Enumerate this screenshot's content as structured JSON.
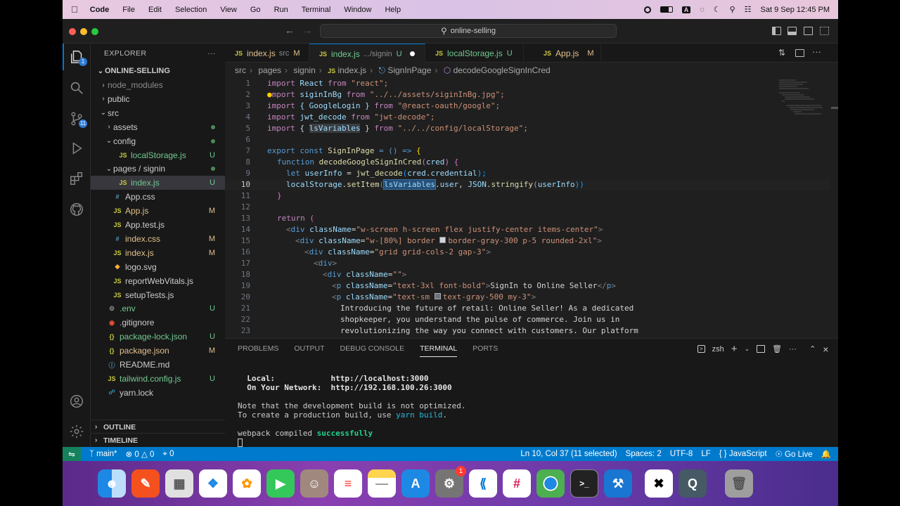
{
  "menubar": {
    "app": "Code",
    "items": [
      "File",
      "Edit",
      "Selection",
      "View",
      "Go",
      "Run",
      "Terminal",
      "Window",
      "Help"
    ],
    "datetime": "Sat 9 Sep  12:45 PM",
    "input_source": "A"
  },
  "window": {
    "search": "online-selling"
  },
  "activity": {
    "source_control_badge": "11",
    "account_badge": "1"
  },
  "explorer": {
    "title": "EXPLORER",
    "project": "ONLINE-SELLING",
    "rows": [
      {
        "label": "node_modules",
        "type": "folder",
        "depth": 1,
        "collapsed": true,
        "status": "",
        "muted": true
      },
      {
        "label": "public",
        "type": "folder",
        "depth": 1,
        "collapsed": true,
        "status": ""
      },
      {
        "label": "src",
        "type": "folder",
        "depth": 1,
        "collapsed": false,
        "status": ""
      },
      {
        "label": "assets",
        "type": "folder",
        "depth": 2,
        "collapsed": true,
        "status": "dot"
      },
      {
        "label": "config",
        "type": "folder",
        "depth": 2,
        "collapsed": false,
        "status": "dot"
      },
      {
        "label": "localStorage.js",
        "type": "js",
        "depth": 3,
        "status": "U"
      },
      {
        "label": "pages / signin",
        "type": "folder",
        "depth": 2,
        "collapsed": false,
        "status": "dot"
      },
      {
        "label": "index.js",
        "type": "js",
        "depth": 3,
        "status": "U",
        "selected": true
      },
      {
        "label": "App.css",
        "type": "css",
        "depth": 2,
        "status": ""
      },
      {
        "label": "App.js",
        "type": "js",
        "depth": 2,
        "status": "M"
      },
      {
        "label": "App.test.js",
        "type": "js",
        "depth": 2,
        "status": ""
      },
      {
        "label": "index.css",
        "type": "css",
        "depth": 2,
        "status": "M"
      },
      {
        "label": "index.js",
        "type": "js",
        "depth": 2,
        "status": "M"
      },
      {
        "label": "logo.svg",
        "type": "svg",
        "depth": 2,
        "status": ""
      },
      {
        "label": "reportWebVitals.js",
        "type": "js",
        "depth": 2,
        "status": ""
      },
      {
        "label": "setupTests.js",
        "type": "js",
        "depth": 2,
        "status": ""
      },
      {
        "label": ".env",
        "type": "env",
        "depth": 1,
        "status": "U"
      },
      {
        "label": ".gitignore",
        "type": "git",
        "depth": 1,
        "status": ""
      },
      {
        "label": "package-lock.json",
        "type": "json",
        "depth": 1,
        "status": "U"
      },
      {
        "label": "package.json",
        "type": "json",
        "depth": 1,
        "status": "M"
      },
      {
        "label": "README.md",
        "type": "md",
        "depth": 1,
        "status": ""
      },
      {
        "label": "tailwind.config.js",
        "type": "js",
        "depth": 1,
        "status": "U"
      },
      {
        "label": "yarn.lock",
        "type": "yarn",
        "depth": 1,
        "status": ""
      }
    ],
    "outline": "OUTLINE",
    "timeline": "TIMELINE"
  },
  "tabs": [
    {
      "name": "index.js",
      "sub": "src",
      "mark": "M",
      "active": false
    },
    {
      "name": "index.js",
      "sub": ".../signin",
      "mark": "U",
      "active": true,
      "dirty": true
    },
    {
      "name": "localStorage.js",
      "sub": "",
      "mark": "U",
      "active": false
    },
    {
      "name": "App.js",
      "sub": "",
      "mark": "M",
      "active": false
    }
  ],
  "breadcrumbs": [
    "src",
    "pages",
    "signin",
    "index.js",
    "SignInPage",
    "decodeGoogleSignInCred"
  ],
  "code": {
    "current_line": 10,
    "lines": [
      "1",
      "2",
      "3",
      "4",
      "5",
      "6",
      "7",
      "8",
      "9",
      "10",
      "11",
      "12",
      "13",
      "14",
      "15",
      "16",
      "17",
      "18",
      "19",
      "20",
      "21",
      "22",
      "23"
    ],
    "text": {
      "l1": [
        "import",
        " React ",
        "from",
        " \"react\";"
      ],
      "l2": [
        "mport",
        " siginInBg ",
        "from",
        " \"../../assets/siginInBg.jpg\";"
      ],
      "l3": [
        "import",
        " { GoogleLogin } ",
        "from",
        " \"@react-oauth/google\";"
      ],
      "l4": [
        "import",
        " jwt_decode ",
        "from",
        " \"jwt-decode\";"
      ],
      "l5": [
        "import",
        " { ",
        "lsVariables",
        " } ",
        "from",
        " \"../../config/localStorage\";"
      ],
      "l7": [
        "export const",
        " SignInPage",
        " = () => ",
        "{"
      ],
      "l8": [
        "function",
        " decodeGoogleSignInCred",
        "(",
        "cred",
        ") {"
      ],
      "l9": [
        "let",
        " userInfo",
        " = ",
        "jwt_decode",
        "(",
        "cred",
        ".",
        "credential",
        ");"
      ],
      "l10": [
        "localStorage",
        ".",
        "setItem",
        "(",
        "lsVariables",
        ".",
        "user",
        ", ",
        "JSON",
        ".",
        "stringify",
        "(",
        "userInfo",
        "))"
      ],
      "l11": [
        "}"
      ],
      "l13": [
        "return ",
        "("
      ],
      "l14": [
        "<",
        "div",
        " className",
        "=",
        "\"w-screen h-screen flex justify-center items-center\"",
        ">"
      ],
      "l15": [
        "<",
        "div",
        " className",
        "=",
        "\"w-[80%] border ",
        "border-gray-300 p-5 rounded-2xl\"",
        ">"
      ],
      "l16": [
        "<",
        "div",
        " className",
        "=",
        "\"grid grid-cols-2 gap-3\"",
        ">"
      ],
      "l17": [
        "<",
        "div",
        ">"
      ],
      "l18": [
        "<",
        "div",
        " className",
        "=",
        "\"\"",
        ">"
      ],
      "l19": [
        "<",
        "p",
        " className",
        "=",
        "\"text-3xl font-bold\"",
        ">",
        "SignIn to Online Seller",
        "</",
        "p",
        ">"
      ],
      "l20": [
        "<",
        "p",
        " className",
        "=",
        "\"text-sm ",
        "text-gray-500 my-3\"",
        ">"
      ],
      "l21": [
        "Introducing the future of retail: Online Seller! As a dedicated"
      ],
      "l22": [
        "shopkeeper, you understand the pulse of commerce. Join us in"
      ],
      "l23": [
        "revolutionizing the way you connect with customers. Our platform"
      ]
    }
  },
  "panel": {
    "tabs": [
      "PROBLEMS",
      "OUTPUT",
      "DEBUG CONSOLE",
      "TERMINAL",
      "PORTS"
    ],
    "active": "TERMINAL",
    "shell": "zsh",
    "term": {
      "local_label": "  Local:",
      "local_url": "http://localhost:3000",
      "net_label": "  On Your Network:",
      "net_url": "http://192.168.100.26:3000",
      "note1": "Note that the development build is not optimized.",
      "note2a": "To create a production build, use ",
      "note2b": "yarn build",
      "note2c": ".",
      "compiled_a": "webpack compiled ",
      "compiled_b": "successfully"
    }
  },
  "status": {
    "branch": "main*",
    "errors": "0",
    "warnings": "0",
    "ports": "0",
    "position": "Ln 10, Col 37 (11 selected)",
    "spaces": "Spaces: 2",
    "encoding": "UTF-8",
    "eol": "LF",
    "language": "JavaScript",
    "golive": "Go Live"
  },
  "dock": {
    "apps": [
      "Finder",
      "Pixelmator",
      "Launchpad",
      "Safari",
      "Photos",
      "FaceTime",
      "Contacts",
      "Reminders",
      "Notes",
      "App Store",
      "System Settings",
      "VS Code",
      "Slack",
      "Chrome",
      "Terminal",
      "Xcode",
      "CapCut",
      "QuickTime",
      "Trash"
    ],
    "settings_badge": "1"
  }
}
